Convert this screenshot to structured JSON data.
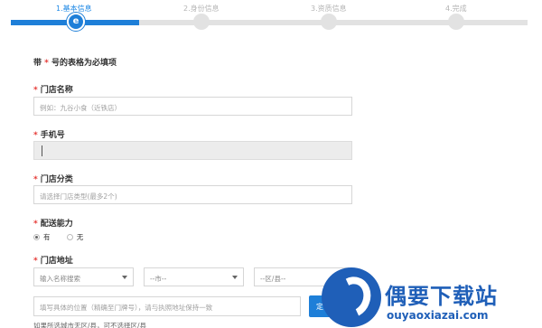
{
  "steps": {
    "items": [
      {
        "label": "1.基本信息",
        "active": true
      },
      {
        "label": "2.身份信息",
        "active": false
      },
      {
        "label": "3.资质信息",
        "active": false
      },
      {
        "label": "4.完成",
        "active": false
      }
    ],
    "active_icon": "e"
  },
  "form": {
    "required_mark": "*",
    "notice_prefix": "带",
    "notice_suffix": " 号的表格为必填项",
    "store_name": {
      "label": "门店名称",
      "placeholder": "例如：九谷小食（近铁店）"
    },
    "phone": {
      "label": "手机号",
      "value": ""
    },
    "category": {
      "label": "门店分类",
      "placeholder": "请选择门店类型(最多2个)"
    },
    "delivery": {
      "label": "配送能力",
      "options": [
        {
          "label": "有",
          "checked": true
        },
        {
          "label": "无",
          "checked": false
        }
      ]
    },
    "address": {
      "label": "门店地址",
      "city_search": "输入名称搜索",
      "city_select": "--市--",
      "district_select": "--区/县--",
      "detail_placeholder": "填写具体的位置（精确至门牌号），请与执照地址保持一致",
      "mark_button": "定位标记",
      "footnote": "如果所选城市无区/县，可不选择区/县"
    }
  },
  "watermark": {
    "brand": "偶要下载站",
    "domain": "ouyaoxiazai.com"
  },
  "colors": {
    "accent": "#1e7fd8",
    "required": "#e53935",
    "watermark": "#1f5fb8"
  }
}
